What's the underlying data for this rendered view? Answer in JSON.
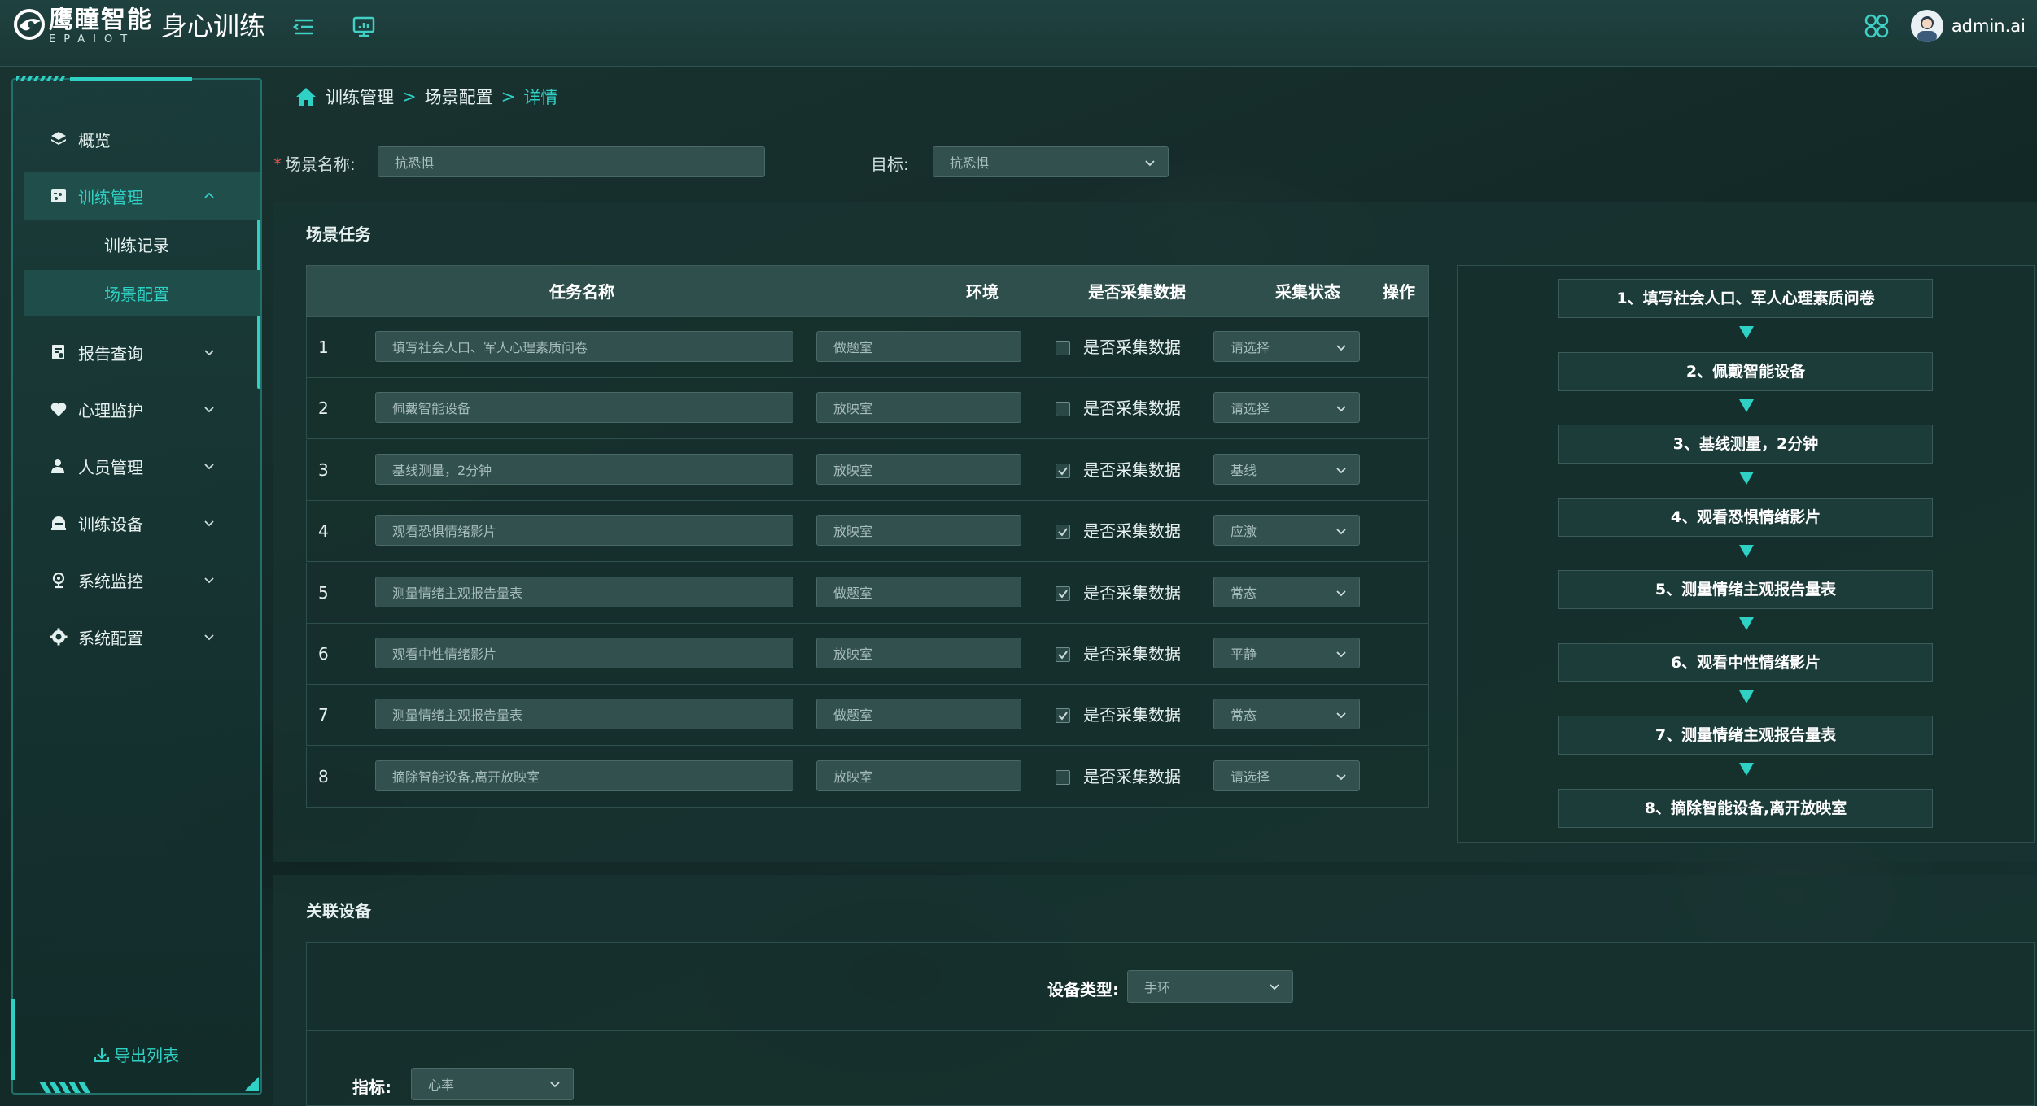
{
  "header": {
    "brand_cn": "鹰瞳智能",
    "brand_en": "EPAIOT",
    "app_title": "身心训练",
    "user_name": "admin.ai"
  },
  "sidebar": {
    "items": [
      {
        "label": "概览",
        "icon": "layers-icon"
      },
      {
        "label": "训练管理",
        "icon": "training-icon",
        "expanded": true
      },
      {
        "label": "报告查询",
        "icon": "report-icon"
      },
      {
        "label": "心理监护",
        "icon": "heart-icon"
      },
      {
        "label": "人员管理",
        "icon": "user-icon"
      },
      {
        "label": "训练设备",
        "icon": "device-icon"
      },
      {
        "label": "系统监控",
        "icon": "monitor-icon"
      },
      {
        "label": "系统配置",
        "icon": "gear-icon"
      }
    ],
    "sub_items": [
      {
        "label": "训练记录"
      },
      {
        "label": "场景配置",
        "active": true
      }
    ],
    "export_label": "导出列表"
  },
  "breadcrumb": {
    "home": "训练管理",
    "sep": ">",
    "level2": "场景配置",
    "current": "详情"
  },
  "form": {
    "required_mark": "*",
    "scene_name_label": "场景名称:",
    "scene_name_value": "抗恐惧",
    "goal_label": "目标:",
    "goal_value": "抗恐惧"
  },
  "tasks": {
    "section_title": "场景任务",
    "columns": [
      "任务名称",
      "环境",
      "是否采集数据",
      "采集状态",
      "操作"
    ],
    "rows": [
      {
        "index": "1",
        "name": "填写社会人口、军人心理素质问卷",
        "env": "做题室",
        "collect": false,
        "collect_label": "是否采集数据",
        "status": "请选择"
      },
      {
        "index": "2",
        "name": "佩戴智能设备",
        "env": "放映室",
        "collect": false,
        "collect_label": "是否采集数据",
        "status": "请选择"
      },
      {
        "index": "3",
        "name": "基线测量，2分钟",
        "env": "放映室",
        "collect": true,
        "collect_label": "是否采集数据",
        "status": "基线"
      },
      {
        "index": "4",
        "name": "观看恐惧情绪影片",
        "env": "放映室",
        "collect": true,
        "collect_label": "是否采集数据",
        "status": "应激"
      },
      {
        "index": "5",
        "name": "测量情绪主观报告量表",
        "env": "做题室",
        "collect": true,
        "collect_label": "是否采集数据",
        "status": "常态"
      },
      {
        "index": "6",
        "name": "观看中性情绪影片",
        "env": "放映室",
        "collect": true,
        "collect_label": "是否采集数据",
        "status": "平静"
      },
      {
        "index": "7",
        "name": "测量情绪主观报告量表",
        "env": "做题室",
        "collect": true,
        "collect_label": "是否采集数据",
        "status": "常态"
      },
      {
        "index": "8",
        "name": "摘除智能设备,离开放映室",
        "env": "放映室",
        "collect": false,
        "collect_label": "是否采集数据",
        "status": "请选择"
      }
    ]
  },
  "flow": {
    "steps": [
      "1、填写社会人口、军人心理素质问卷",
      "2、佩戴智能设备",
      "3、基线测量，2分钟",
      "4、观看恐惧情绪影片",
      "5、测量情绪主观报告量表",
      "6、观看中性情绪影片",
      "7、测量情绪主观报告量表",
      "8、摘除智能设备,离开放映室"
    ]
  },
  "device": {
    "section_title": "关联设备",
    "type_label": "设备类型:",
    "type_value": "手环",
    "metric_label": "指标:",
    "metric_value": "心率"
  },
  "colors": {
    "accent": "#2fd1c4",
    "header_bg": "#1f4240",
    "panel_bg": "#183432"
  }
}
